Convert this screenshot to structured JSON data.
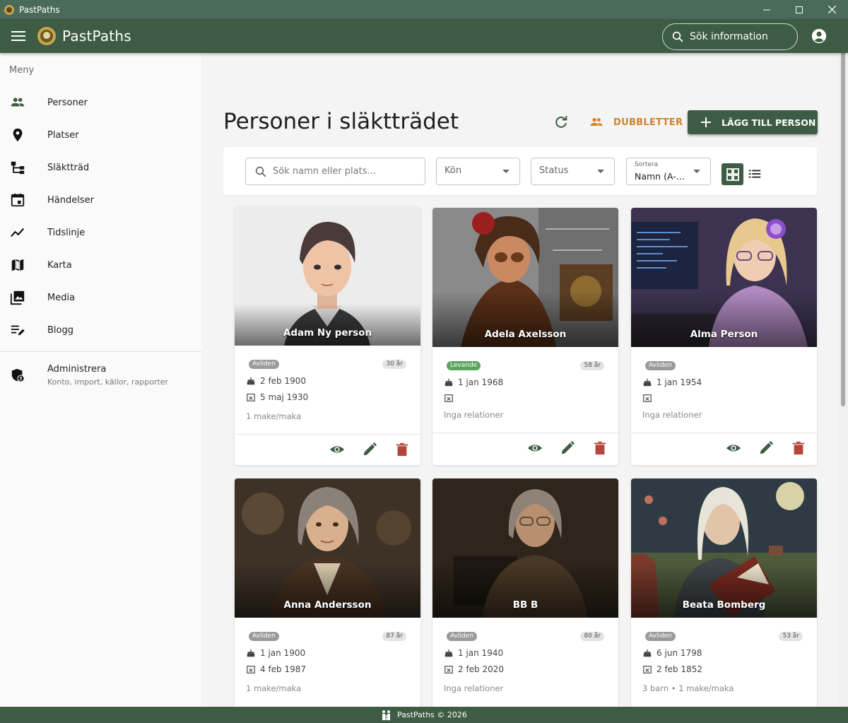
{
  "window": {
    "title": "PastPaths"
  },
  "appbar": {
    "brand": "PastPaths",
    "search_label": "Sök information"
  },
  "sidebar": {
    "menu_label": "Meny",
    "items": [
      {
        "label": "Personer",
        "icon": "people-icon"
      },
      {
        "label": "Platser",
        "icon": "place-pin-icon"
      },
      {
        "label": "Släktträd",
        "icon": "tree-icon"
      },
      {
        "label": "Händelser",
        "icon": "calendar-event-icon"
      },
      {
        "label": "Tidslinje",
        "icon": "timeline-icon"
      },
      {
        "label": "Karta",
        "icon": "map-icon"
      },
      {
        "label": "Media",
        "icon": "photo-library-icon"
      },
      {
        "label": "Blogg",
        "icon": "edit-note-icon"
      }
    ],
    "admin": {
      "label": "Administrera",
      "sub": "Konto, import, källor, rapporter"
    }
  },
  "main": {
    "title": "Personer i släktträdet",
    "duplicates_label": "DUBBLETTER",
    "add_label": "LÄGG TILL PERSON",
    "filters": {
      "search_placeholder": "Sök namn eller plats...",
      "gender": "Kön",
      "status": "Status",
      "sort_label": "Sortera",
      "sort_value": "Namn (A-..."
    }
  },
  "colors": {
    "primary": "#3e5c43",
    "accent": "#d0832b",
    "delete": "#b5453a",
    "alive": "#5aa55e"
  },
  "persons": [
    {
      "name": "Adam Ny person",
      "status": "Avliden",
      "age": "30 år",
      "born": "2 feb 1900",
      "died": "5 maj 1930",
      "relations": "1 make/maka"
    },
    {
      "name": "Adela Axelsson",
      "status": "Levande",
      "age": "58 år",
      "born": "1 jan 1968",
      "died": "",
      "relations": "Inga relationer"
    },
    {
      "name": "Alma Person",
      "status": "Avliden",
      "age": "",
      "born": "1 jan 1954",
      "died": "",
      "relations": "Inga relationer"
    },
    {
      "name": "Anna Andersson",
      "status": "Avliden",
      "age": "87 år",
      "born": "1 jan 1900",
      "died": "4 feb 1987",
      "relations": "1 make/maka"
    },
    {
      "name": "BB B",
      "status": "Avliden",
      "age": "80 år",
      "born": "1 jan 1940",
      "died": "2 feb 2020",
      "relations": "Inga relationer"
    },
    {
      "name": "Beata Bomberg",
      "status": "Avliden",
      "age": "53 år",
      "born": "6 jun 1798",
      "died": "2 feb 1852",
      "relations": "3 barn • 1 make/maka"
    }
  ],
  "footer": {
    "text": "PastPaths © 2026"
  }
}
